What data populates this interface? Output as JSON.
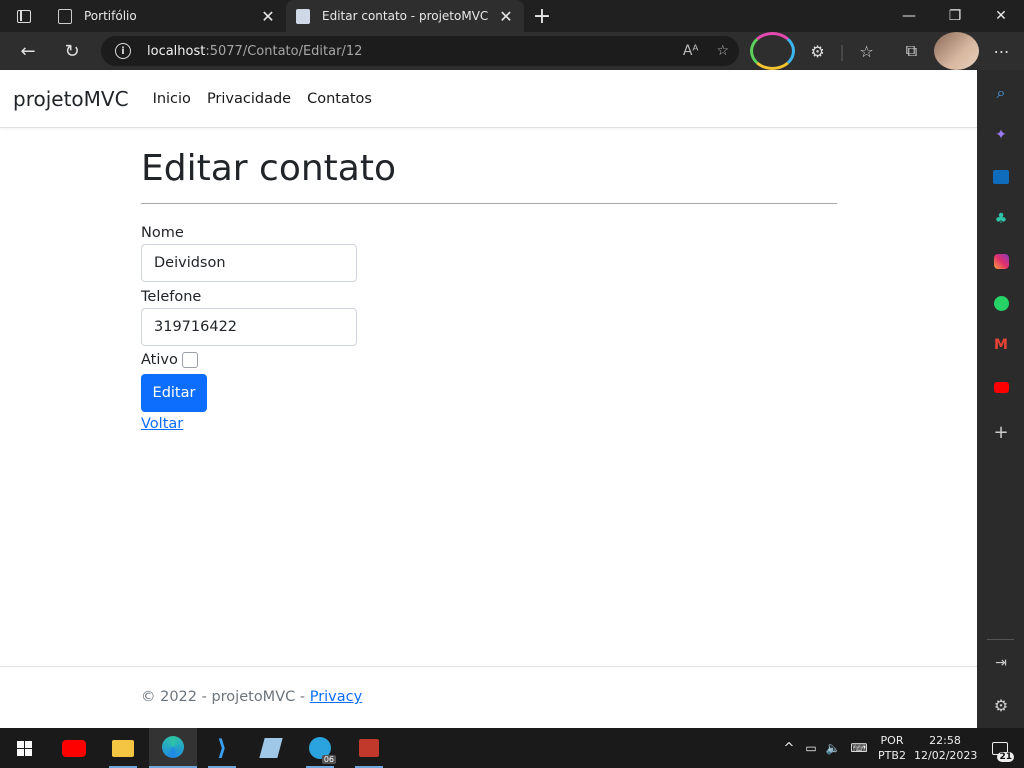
{
  "browser": {
    "tabs": [
      {
        "title": "Portifólio",
        "active": false
      },
      {
        "title": "Editar contato - projetoMVC",
        "active": true
      }
    ],
    "url_host": "localhost",
    "url_path": ":5077/Contato/Editar/12"
  },
  "navbar": {
    "brand": "projetoMVC",
    "links": [
      "Inicio",
      "Privacidade",
      "Contatos"
    ]
  },
  "main": {
    "heading": "Editar contato",
    "fields": [
      {
        "label": "Nome",
        "value": "Deividson"
      },
      {
        "label": "Telefone",
        "value": "319716422"
      }
    ],
    "checkbox": {
      "label": "Ativo",
      "checked": false
    },
    "submit_label": "Editar",
    "back_label": "Voltar"
  },
  "footer": {
    "text": "© 2022 - projetoMVC - ",
    "link": "Privacy"
  },
  "taskbar": {
    "lang": "POR",
    "layout": "PTB2",
    "time": "22:58",
    "date": "12/02/2023",
    "notifications": "21",
    "telegram_badge": "06"
  },
  "colors": {
    "primary": "#0d6efd",
    "chrome": "#202020",
    "sidebar": "#2b2b2b",
    "taskbar": "#1a1a1a"
  }
}
